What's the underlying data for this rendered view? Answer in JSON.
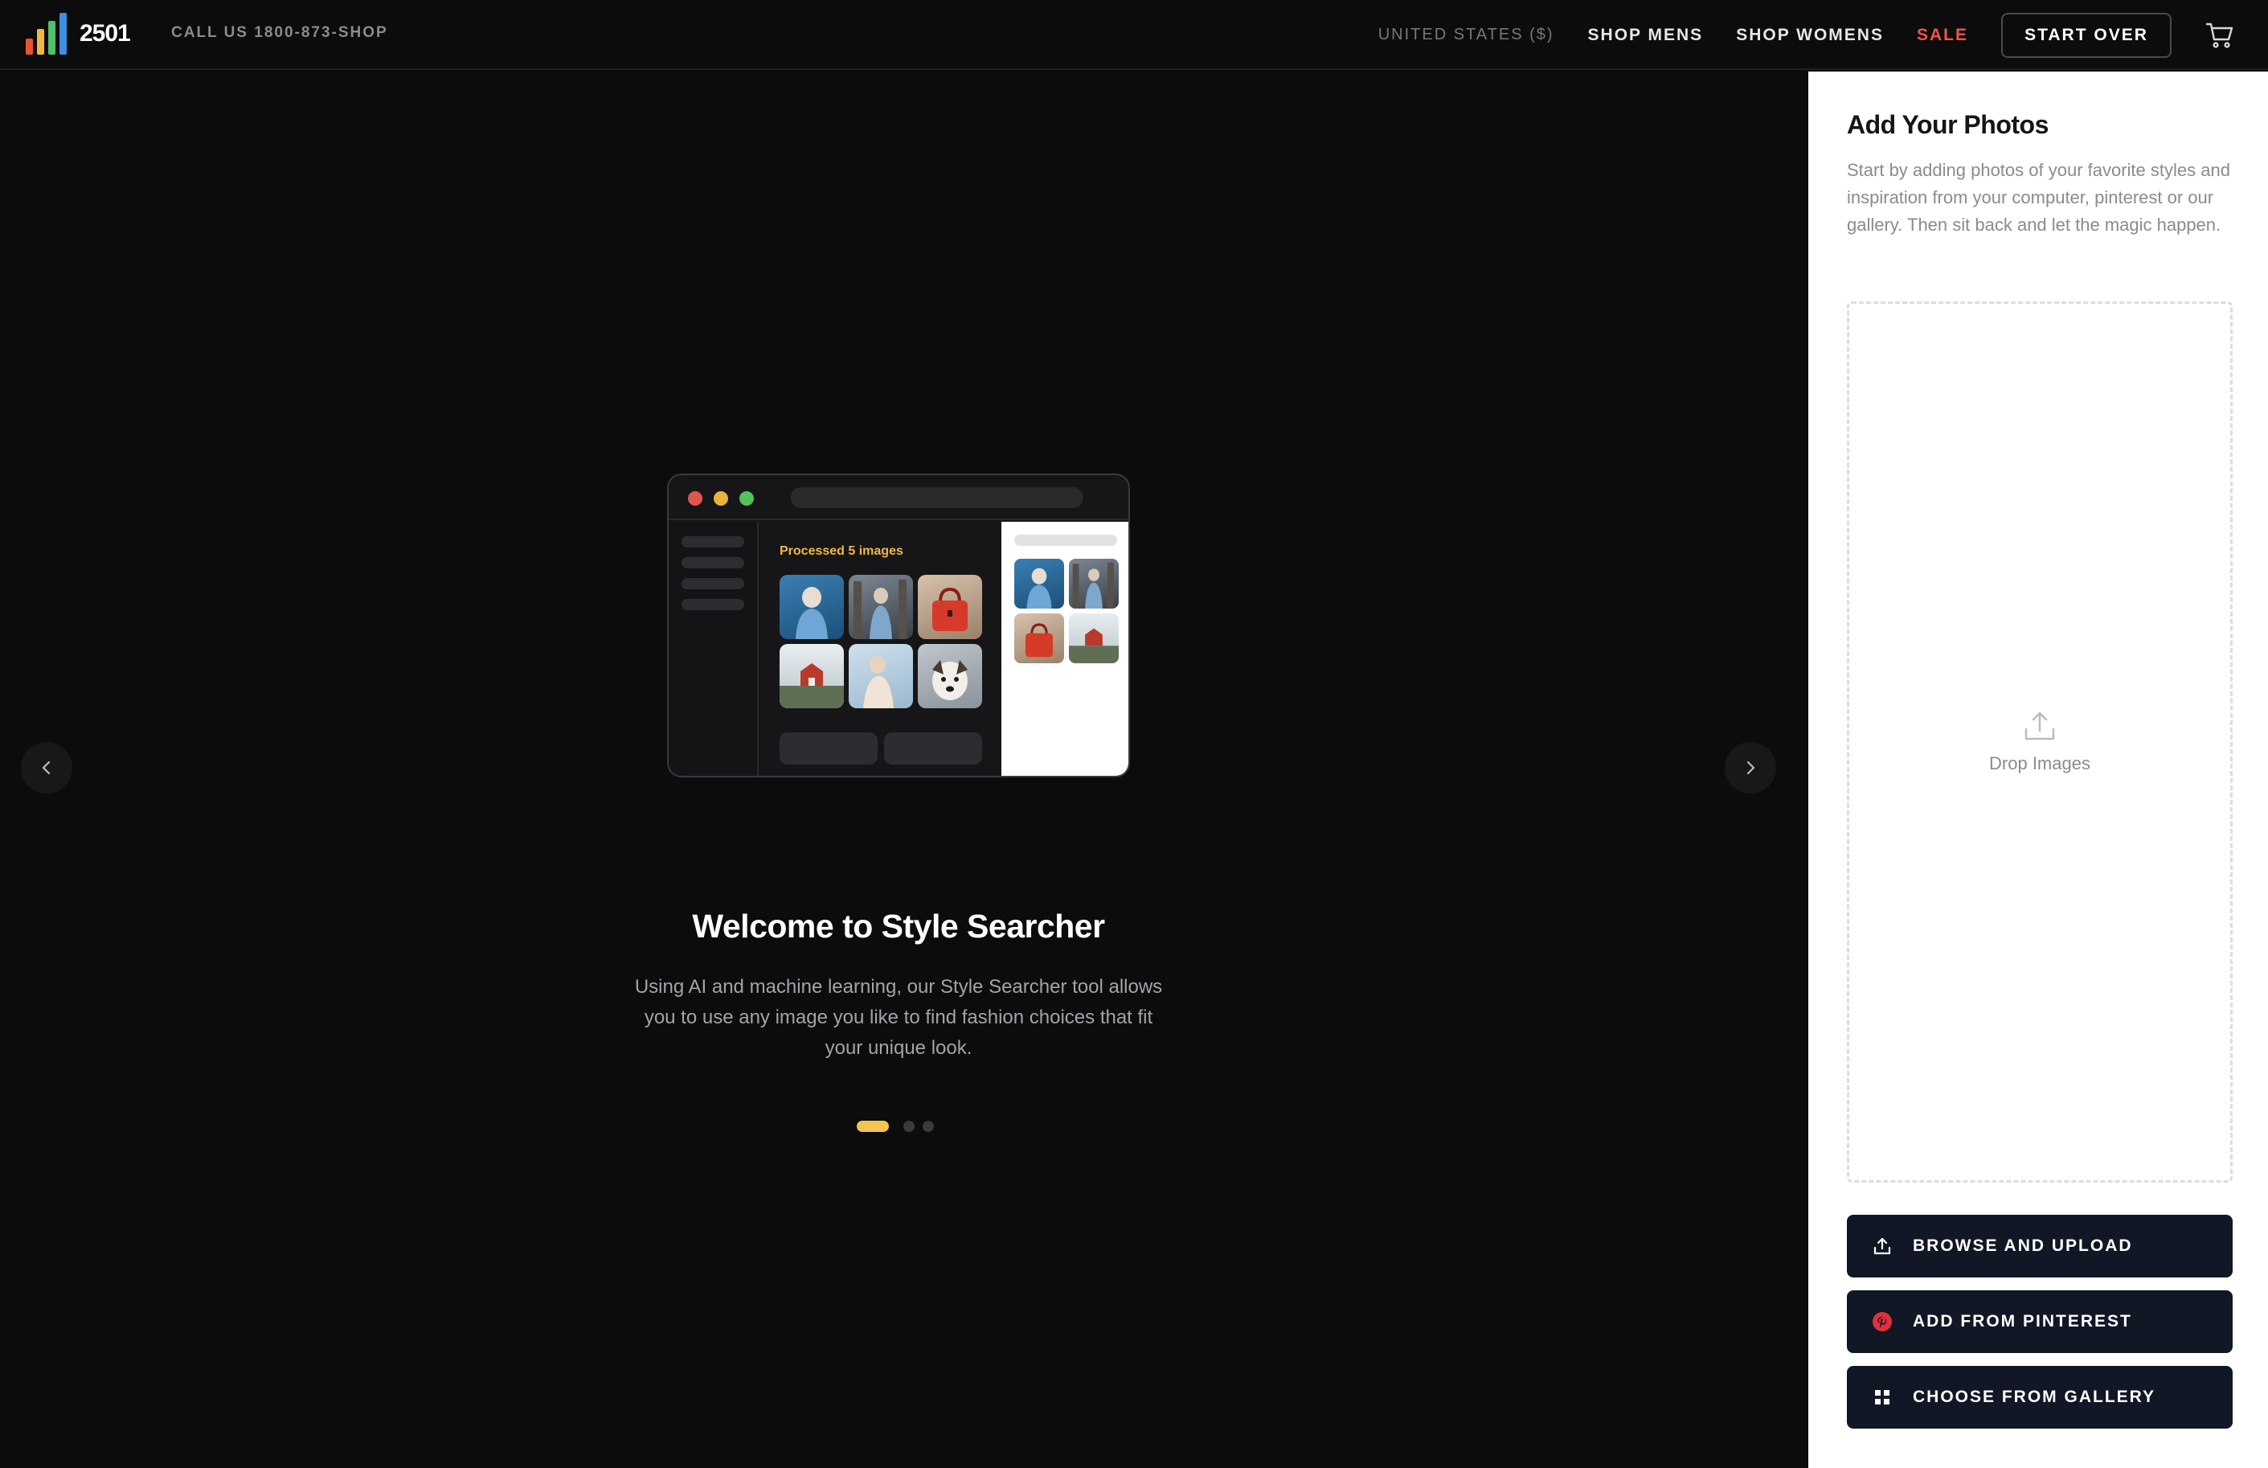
{
  "brand": {
    "name": "2501",
    "phone": "CALL US 1800-873-SHOP",
    "bar_colors": [
      "#e8542f",
      "#f3b843",
      "#4fbf6a",
      "#3d8fe0"
    ]
  },
  "nav": {
    "country": "UNITED STATES ($)",
    "shop_mens": "SHOP MENS",
    "shop_womens": "SHOP WOMENS",
    "sale": "SALE",
    "start_over": "START OVER",
    "cart_icon": "cart-icon"
  },
  "carousel": {
    "mockup": {
      "processed_label": "Processed 5 images",
      "window_dots": [
        "#e0564c",
        "#e9b43c",
        "#54c25c"
      ]
    },
    "title": "Welcome to Style Searcher",
    "description": "Using AI and machine learning, our Style Searcher tool allows you to use any image you like to find fashion choices that fit your unique look.",
    "pages": 3,
    "active_page": 1,
    "accent": "#f3c450"
  },
  "panel": {
    "title": "Add Your Photos",
    "description": "Start by adding photos of your favorite styles and inspiration from your computer, pinterest or our gallery. Then sit back and let the magic happen.",
    "drop_label": "Drop Images",
    "buttons": {
      "browse": "BROWSE AND UPLOAD",
      "pinterest": "ADD FROM PINTEREST",
      "gallery": "CHOOSE FROM GALLERY"
    },
    "button_color": "#121726",
    "pinterest_color": "#e0303a"
  }
}
